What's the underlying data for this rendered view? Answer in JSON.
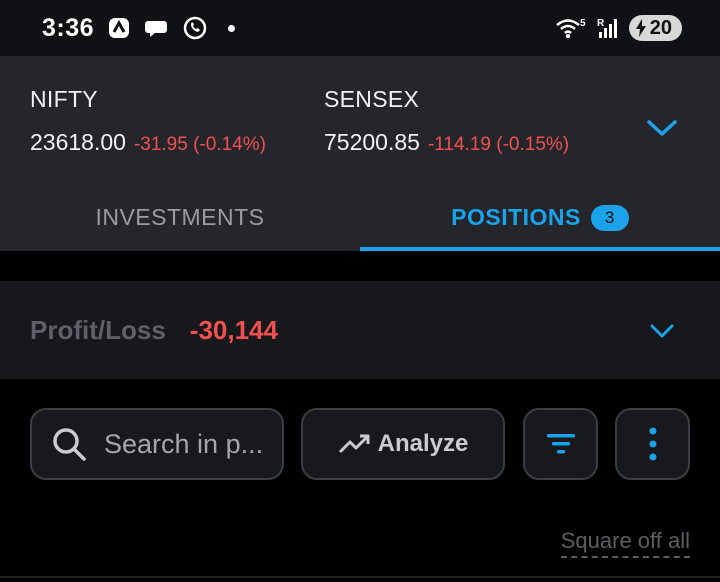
{
  "status_bar": {
    "time": "3:36",
    "left_icons": [
      "swiggy-app-icon",
      "chat-bubble-icon",
      "whatsapp-icon"
    ],
    "wifi_label": "5",
    "signal_label": "R",
    "battery": "20"
  },
  "indices": [
    {
      "name": "NIFTY",
      "price": "23618.00",
      "change": "-31.95 (-0.14%)"
    },
    {
      "name": "SENSEX",
      "price": "75200.85",
      "change": "-114.19 (-0.15%)"
    }
  ],
  "tabs": [
    {
      "label": "INVESTMENTS",
      "active": false
    },
    {
      "label": "POSITIONS",
      "active": true,
      "badge": "3"
    }
  ],
  "pnl": {
    "label": "Profit/Loss",
    "value": "-30,144"
  },
  "toolbar": {
    "search_placeholder": "Search in p...",
    "analyze_label": "Analyze"
  },
  "square_off_label": "Square off all",
  "colors": {
    "accent": "#1aa3ea",
    "loss": "#f25050",
    "header_bg": "#24262b",
    "pl_bg": "#16181b"
  }
}
